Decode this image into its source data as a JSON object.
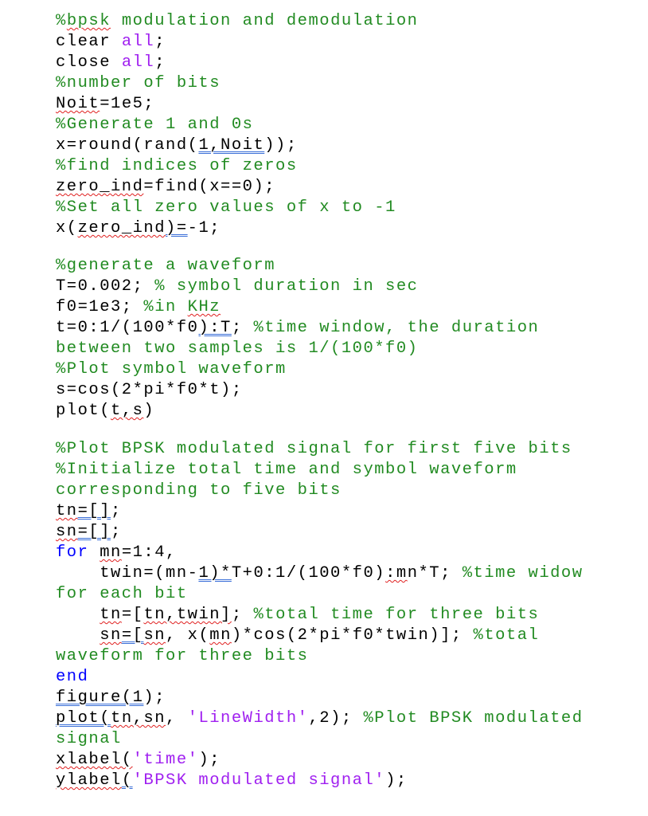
{
  "document": {
    "language": "MATLAB",
    "colors": {
      "code": "#000000",
      "comment": "#228B22",
      "string": "#A020F0",
      "keyword": "#0000FF",
      "spelling_underline": "#E02020",
      "grammar_underline": "#3A6FD8"
    },
    "lines": [
      {
        "c": "%bpsk modulation and demodulation"
      },
      {
        "a": "clear ",
        "s": "all",
        ";": ";"
      },
      {
        "a": "close ",
        "s": "all",
        ";": ";"
      },
      {
        "c": "%number of bits"
      },
      {
        "code": "Noit=1e5;"
      },
      {
        "c": "%Generate 1 and 0s"
      },
      {
        "code": "x=round(rand(1,Noit));"
      },
      {
        "c": "%find indices of zeros"
      },
      {
        "code": "zero_ind=find(x==0);"
      },
      {
        "c": "%Set all zero values of x to -1"
      },
      {
        "code": "x(zero_ind)=-1;"
      },
      {
        "c": "%generate a waveform"
      },
      {
        "code": "T=0.002; ",
        "c": "% symbol duration in sec"
      },
      {
        "code": "f0=1e3; ",
        "c": "%in KHz"
      },
      {
        "code": "t=0:1/(100*f0):T; ",
        "c": "%time window, the duration"
      },
      {
        "c": "between two samples is 1/(100*f0)"
      },
      {
        "c": "%Plot symbol waveform"
      },
      {
        "code": "s=cos(2*pi*f0*t);"
      },
      {
        "code": "plot(t,s)"
      },
      {
        "c": "%Plot BPSK modulated signal for first five bits"
      },
      {
        "c": "%Initialize total time and symbol waveform"
      },
      {
        "c": "corresponding to five bits"
      },
      {
        "code": "tn=[];"
      },
      {
        "code": "sn=[];"
      },
      {
        "k": "for",
        "code": " mn=1:4,"
      },
      {
        "code": "    twin=(mn-1)*T+0:1/(100*f0):mn*T; ",
        "c": "%time widow"
      },
      {
        "c": "for each bit"
      },
      {
        "code": "    tn=[tn,twin]; ",
        "c": "%total time for three bits"
      },
      {
        "code": "    sn=[sn, x(mn)*cos(2*pi*f0*twin)]; ",
        "c": "%total"
      },
      {
        "c": "waveform for three bits"
      },
      {
        "k": "end"
      },
      {
        "code": "figure(1);"
      },
      {
        "code": "plot(tn,sn, ",
        "s": "'LineWidth'",
        "code2": ",2); ",
        "c": "%Plot BPSK modulated"
      },
      {
        "c": "signal"
      },
      {
        "code": "xlabel(",
        "s": "'time'",
        "code2": ");"
      },
      {
        "code": "ylabel(",
        "s": "'BPSK modulated signal'",
        "code2": ");"
      }
    ]
  }
}
